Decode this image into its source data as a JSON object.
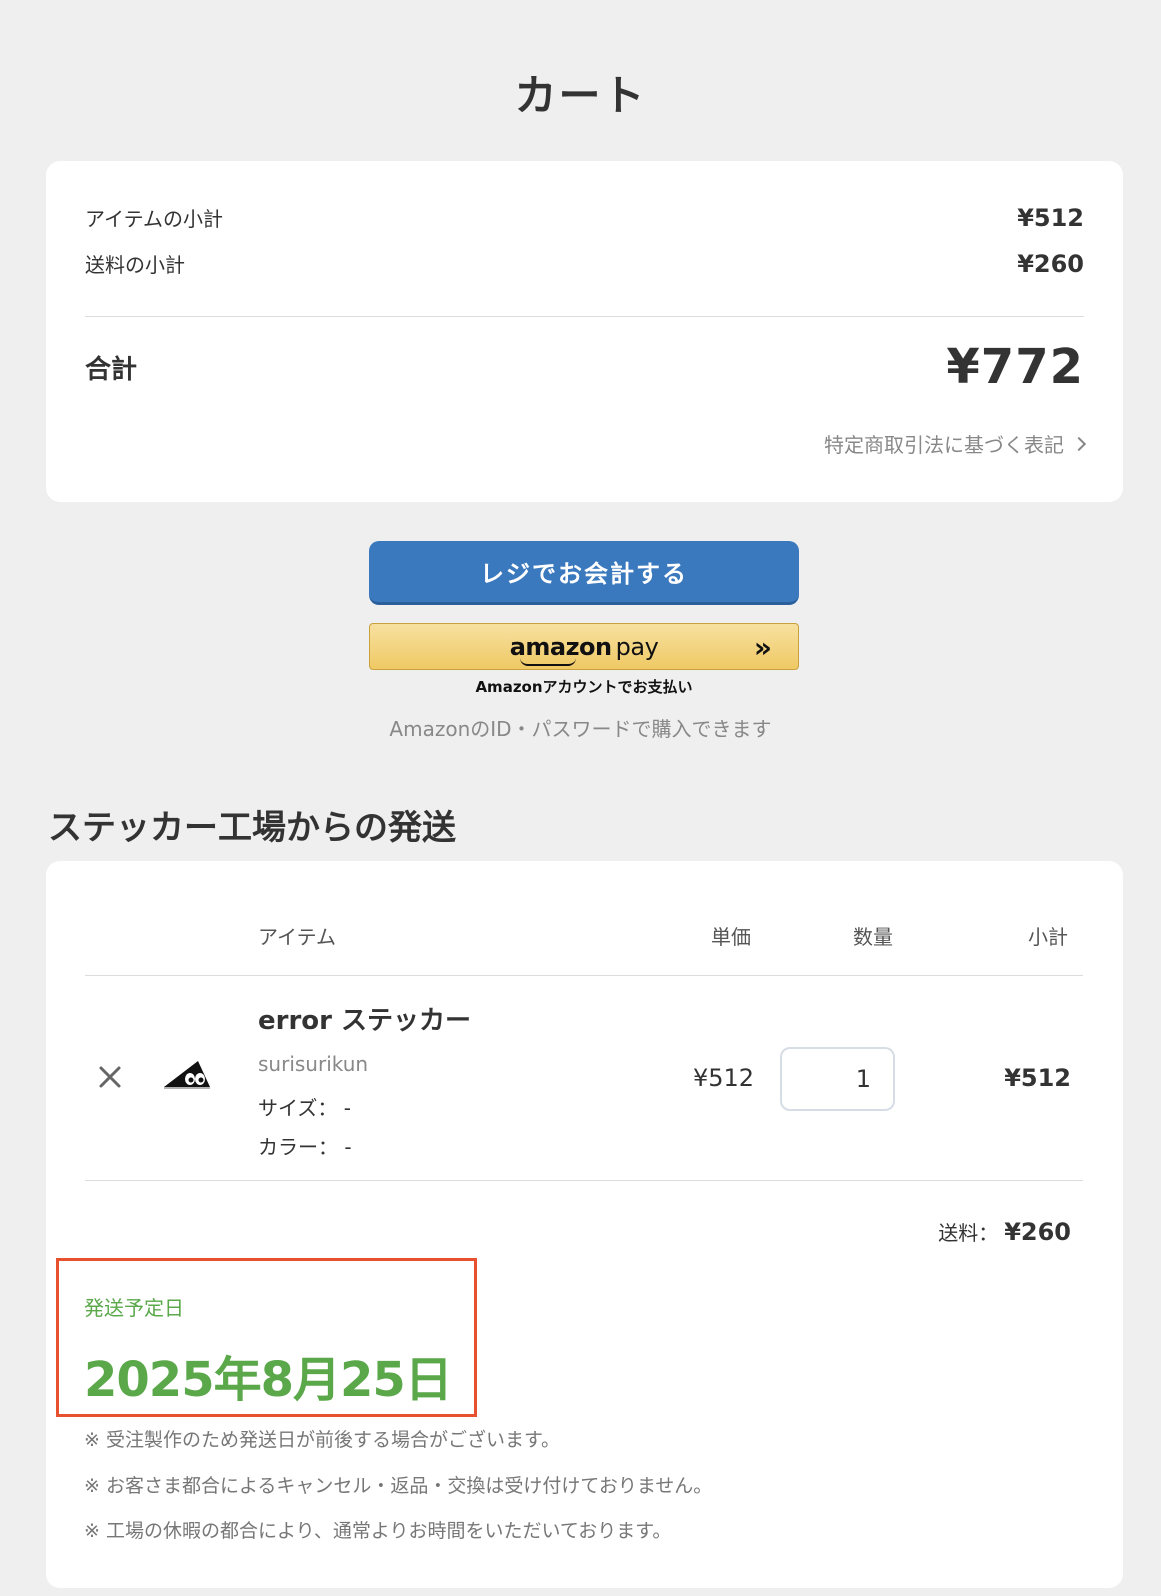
{
  "page": {
    "title": "カート"
  },
  "summary": {
    "items_subtotal_label": "アイテムの小計",
    "items_subtotal_value": "¥512",
    "shipping_subtotal_label": "送料の小計",
    "shipping_subtotal_value": "¥260",
    "total_label": "合計",
    "total_value": "¥772",
    "legal_link": "特定商取引法に基づく表記"
  },
  "checkout": {
    "register_button": "レジでお会計する",
    "amazon_logo_word": "amazon",
    "amazon_logo_pay": "pay",
    "amazon_arrows": "»",
    "amazon_caption": "Amazonアカウントでお支払い",
    "amazon_note": "AmazonのID・パスワードで購入できます"
  },
  "shipment": {
    "section_title": "ステッカー工場からの発送",
    "headers": {
      "item": "アイテム",
      "unit_price": "単価",
      "quantity": "数量",
      "subtotal": "小計"
    },
    "item": {
      "name": "error ステッカー",
      "seller": "surisurikun",
      "size": "サイズ： -",
      "color": "カラー： -",
      "unit_price": "¥512",
      "quantity": "1",
      "subtotal": "¥512"
    },
    "shipping_fee_label": "送料：",
    "shipping_fee_value": "¥260",
    "ship_date_label": "発送予定日",
    "ship_date_value": "2025年8月25日",
    "notes": [
      "※ 受注製作のため発送日が前後する場合がございます。",
      "※ お客さま都合によるキャンセル・返品・交換は受け付けておりません。",
      "※ 工場の休暇の都合により、通常よりお時間をいただいております。"
    ]
  },
  "colors": {
    "background": "#efefef",
    "primary_button": "#3b79bf",
    "amazon_button": "#efc964",
    "ship_date_green": "#5aa84a",
    "highlight_border": "#e8512d"
  },
  "icons": [
    "chevron-right-icon",
    "close-icon",
    "amazon-pay-arrows-icon",
    "sticker-thumbnail"
  ]
}
